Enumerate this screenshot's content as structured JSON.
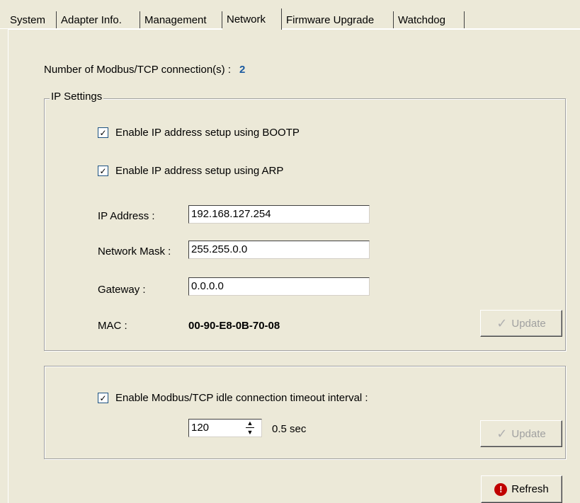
{
  "tabs": [
    {
      "label": "System"
    },
    {
      "label": "Adapter Info."
    },
    {
      "label": "Management"
    },
    {
      "label": "Network",
      "active": true
    },
    {
      "label": "Firmware Upgrade"
    },
    {
      "label": "Watchdog"
    }
  ],
  "connections": {
    "label": "Number of Modbus/TCP connection(s) :",
    "value": "2"
  },
  "ip_settings": {
    "title": "IP Settings",
    "bootp": {
      "label": "Enable IP address setup using BOOTP",
      "checked": true
    },
    "arp": {
      "label": "Enable IP address setup using ARP",
      "checked": true
    },
    "ip_address": {
      "label": "IP Address :",
      "value": "192.168.127.254"
    },
    "network_mask": {
      "label": "Network Mask :",
      "value": "255.255.0.0"
    },
    "gateway": {
      "label": "Gateway :",
      "value": "0.0.0.0"
    },
    "mac": {
      "label": "MAC :",
      "value": "00-90-E8-0B-70-08"
    },
    "update_label": "Update"
  },
  "timeout": {
    "enable": {
      "label": "Enable Modbus/TCP idle connection timeout interval :",
      "checked": true
    },
    "value": "120",
    "unit": "0.5 sec",
    "update_label": "Update"
  },
  "refresh_label": "Refresh",
  "icons": {
    "checkmark": "check-icon",
    "refresh": "refresh-icon",
    "spinner": "up-down-arrows-icon"
  }
}
